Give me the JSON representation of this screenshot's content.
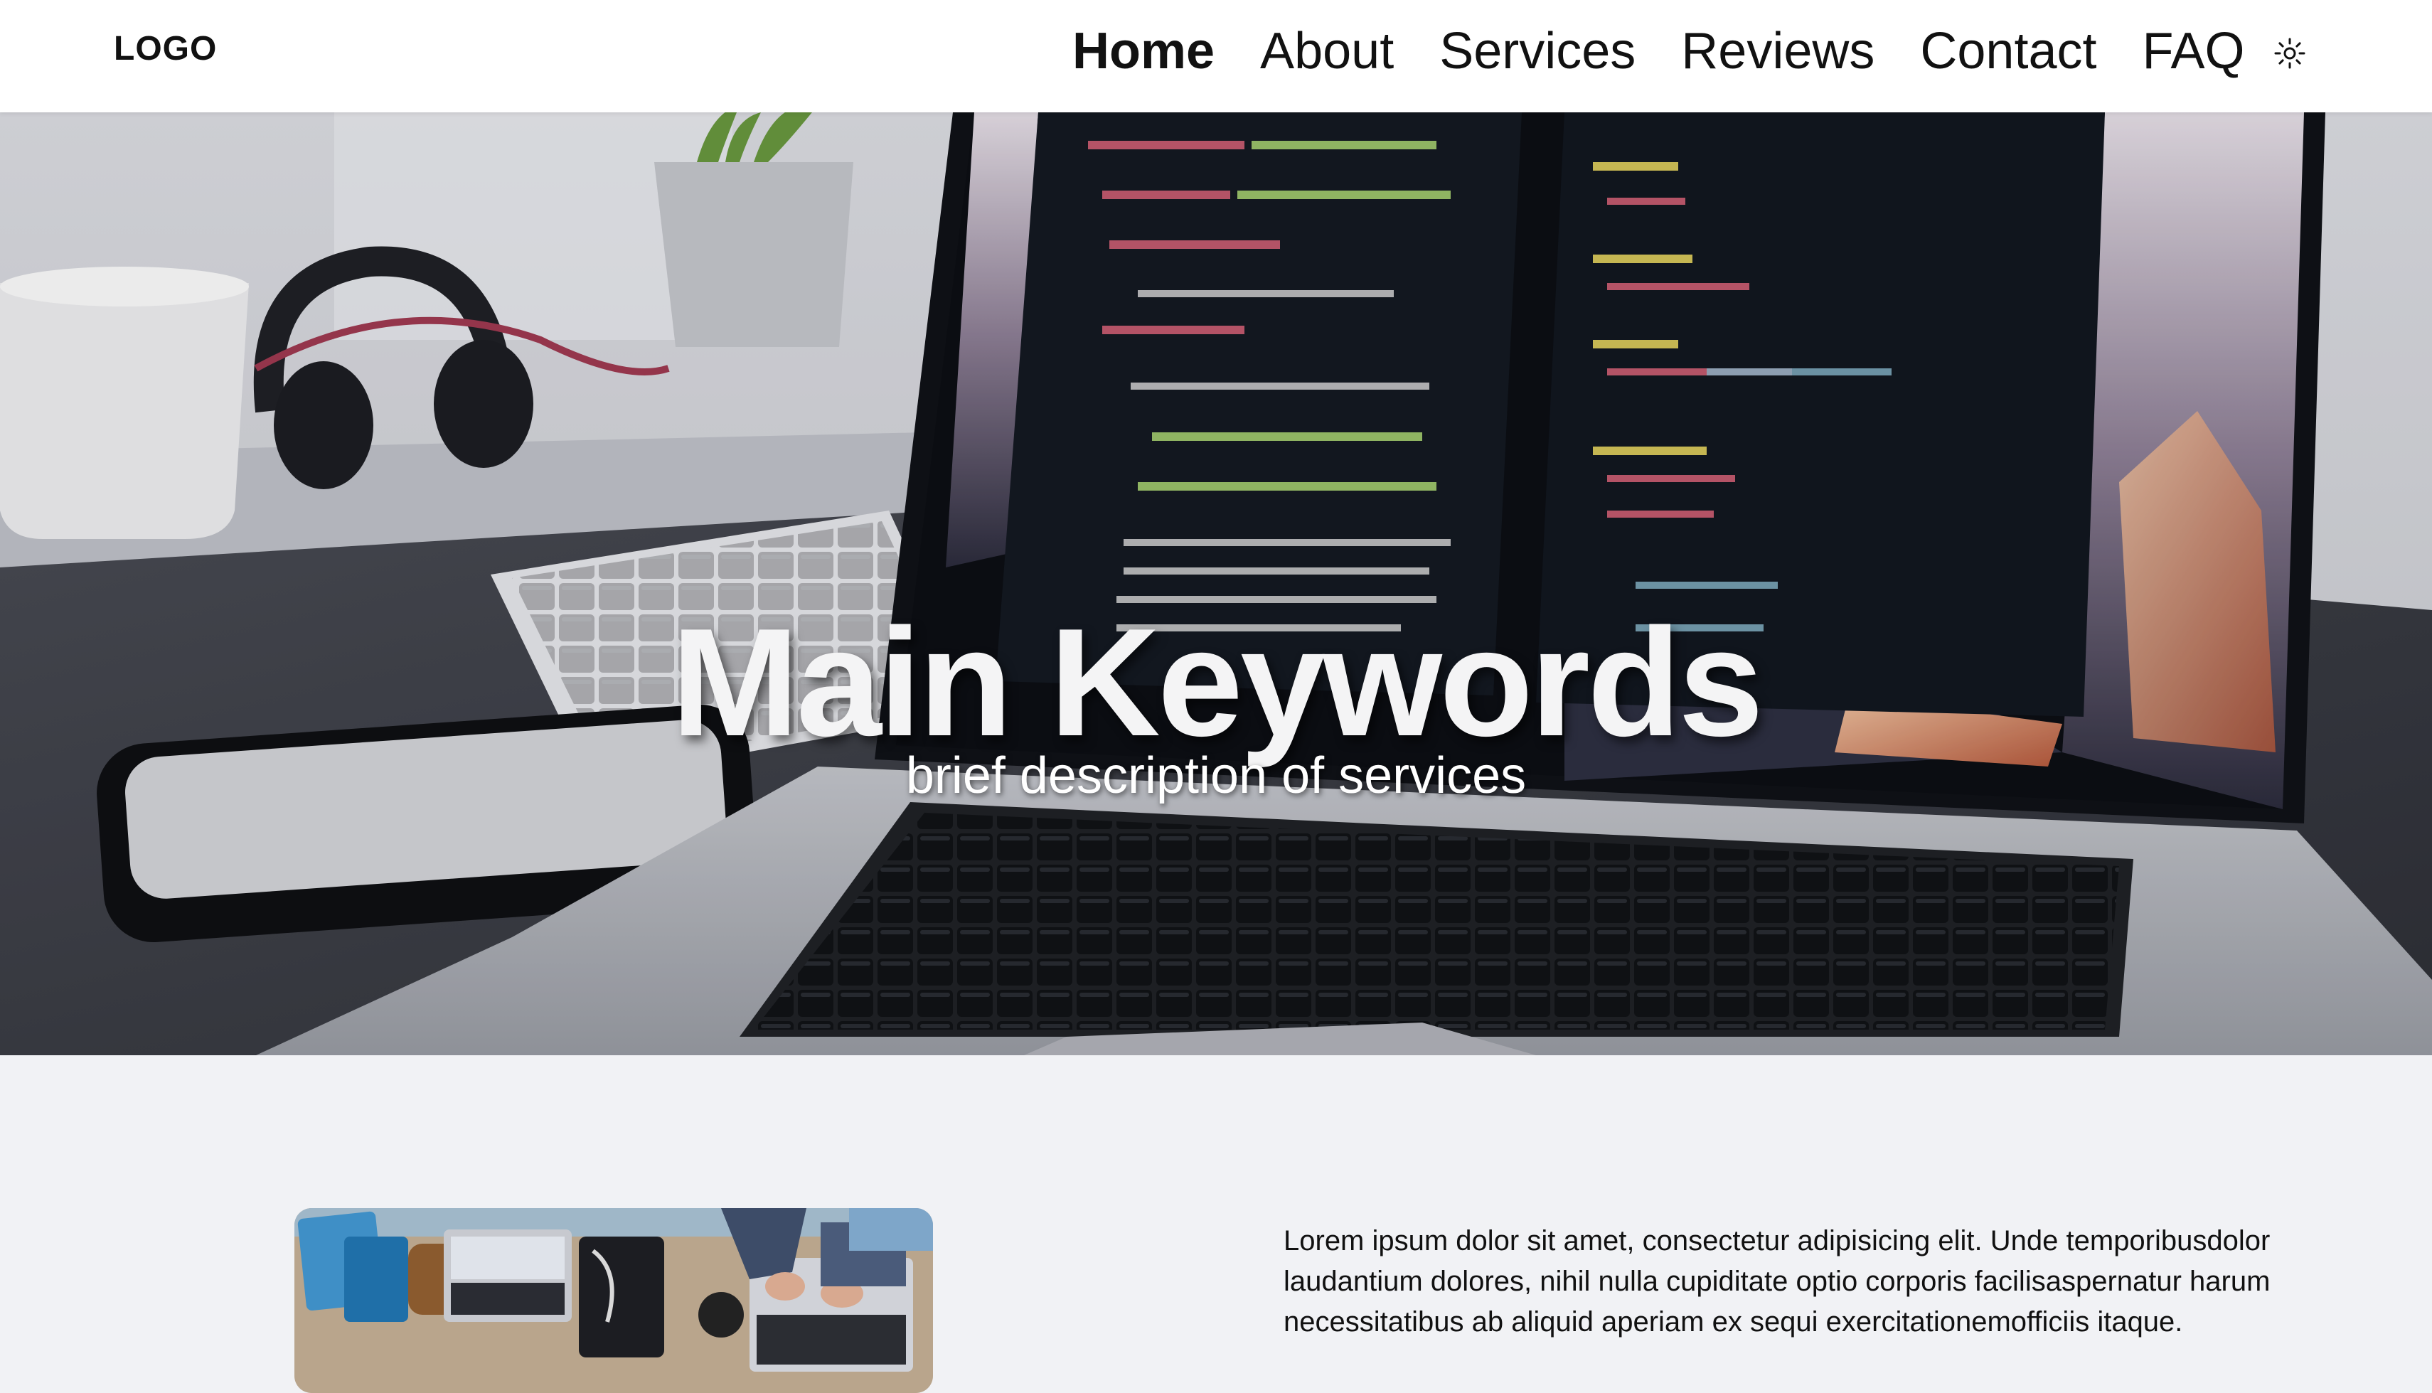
{
  "header": {
    "logo": "LOGO",
    "nav": [
      {
        "label": "Home",
        "active": true
      },
      {
        "label": "About",
        "active": false
      },
      {
        "label": "Services",
        "active": false
      },
      {
        "label": "Reviews",
        "active": false
      },
      {
        "label": "Contact",
        "active": false
      },
      {
        "label": "FAQ",
        "active": false
      }
    ],
    "theme_toggle_icon": "sun-icon"
  },
  "hero": {
    "title": "Main Keywords",
    "subtitle": "brief description of services",
    "image_icon": "laptop-desk-photo"
  },
  "about": {
    "image_icon": "workspace-photo",
    "text": "Lorem ipsum dolor sit amet, consectetur adipisicing elit. Unde temporibusdolor laudantium dolores, nihil nulla cupiditate optio corporis facilisaspernatur harum necessitatibus ab aliquid aperiam ex sequi exercitationemofficiis itaque."
  },
  "colors": {
    "header_bg": "#ffffff",
    "page_bg": "#f1f2f5",
    "text": "#111111",
    "hero_text": "#f4f4f5"
  }
}
